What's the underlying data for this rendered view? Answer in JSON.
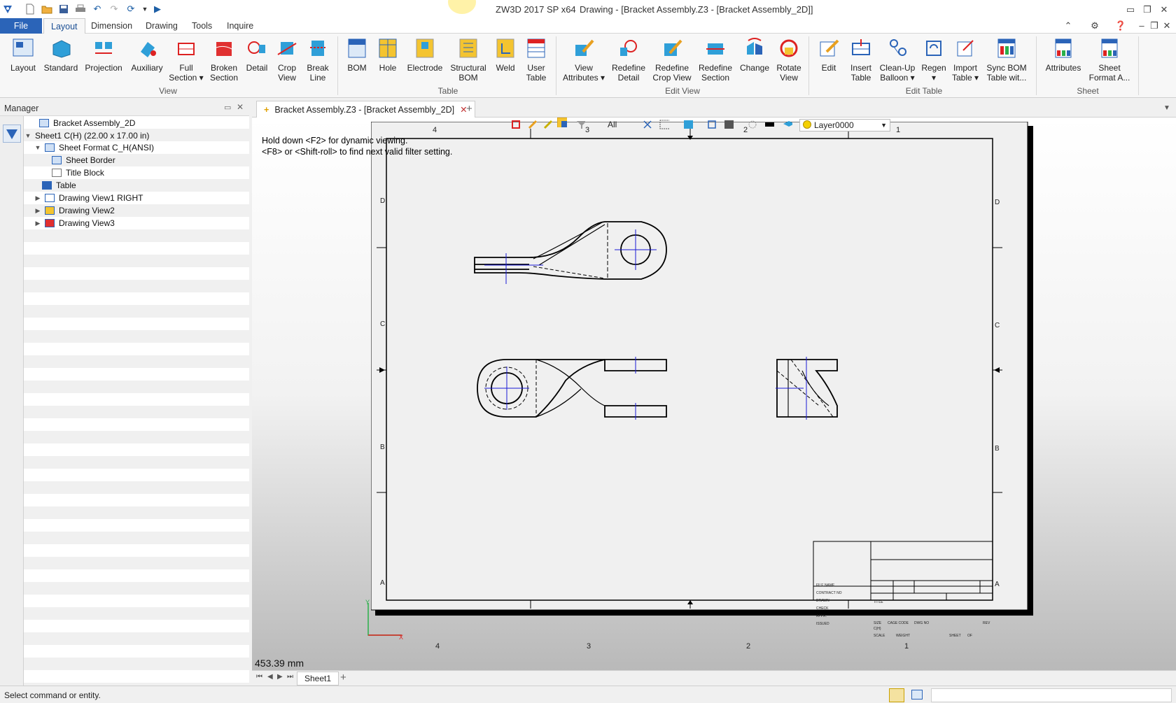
{
  "window": {
    "app_title": "ZW3D 2017 SP x64",
    "doc_title": "Drawing - [Bracket Assembly.Z3 - [Bracket Assembly_2D]]"
  },
  "menu": {
    "file": "File",
    "tabs": [
      "Layout",
      "Dimension",
      "Drawing",
      "Tools",
      "Inquire"
    ]
  },
  "ribbon": {
    "buttons": [
      {
        "l1": "Layout",
        "l2": ""
      },
      {
        "l1": "Standard",
        "l2": ""
      },
      {
        "l1": "Projection",
        "l2": ""
      },
      {
        "l1": "Auxiliary",
        "l2": ""
      },
      {
        "l1": "Full",
        "l2": "Section ▾"
      },
      {
        "l1": "Broken",
        "l2": "Section"
      },
      {
        "l1": "Detail",
        "l2": ""
      },
      {
        "l1": "Crop",
        "l2": "View"
      },
      {
        "l1": "Break",
        "l2": "Line"
      },
      {
        "l1": "BOM",
        "l2": ""
      },
      {
        "l1": "Hole",
        "l2": ""
      },
      {
        "l1": "Electrode",
        "l2": ""
      },
      {
        "l1": "Structural",
        "l2": "BOM"
      },
      {
        "l1": "Weld",
        "l2": ""
      },
      {
        "l1": "User",
        "l2": "Table"
      },
      {
        "l1": "View",
        "l2": "Attributes ▾"
      },
      {
        "l1": "Redefine",
        "l2": "Detail"
      },
      {
        "l1": "Redefine",
        "l2": "Crop View"
      },
      {
        "l1": "Redefine",
        "l2": "Section"
      },
      {
        "l1": "Change",
        "l2": ""
      },
      {
        "l1": "Rotate",
        "l2": "View"
      },
      {
        "l1": "Edit",
        "l2": ""
      },
      {
        "l1": "Insert",
        "l2": "Table"
      },
      {
        "l1": "Clean-Up",
        "l2": "Balloon ▾"
      },
      {
        "l1": "Regen",
        "l2": "▾"
      },
      {
        "l1": "Import",
        "l2": "Table ▾"
      },
      {
        "l1": "Sync BOM",
        "l2": "Table wit..."
      },
      {
        "l1": "Attributes",
        "l2": ""
      },
      {
        "l1": "Sheet",
        "l2": "Format A..."
      }
    ],
    "groups": [
      "View",
      "Table",
      "Edit View",
      "Edit Table",
      "Sheet"
    ]
  },
  "manager": {
    "title": "Manager",
    "tree": [
      {
        "label": "Bracket Assembly_2D",
        "expander": ""
      },
      {
        "label": "Sheet1 C(H) (22.00 x 17.00 in)",
        "expander": "▼"
      },
      {
        "label": "Sheet Format C_H(ANSI)",
        "expander": "▼"
      },
      {
        "label": "Sheet Border",
        "expander": ""
      },
      {
        "label": "Title Block",
        "expander": ""
      },
      {
        "label": "Table",
        "expander": ""
      },
      {
        "label": "Drawing View1 RIGHT",
        "expander": "▶"
      },
      {
        "label": "Drawing View2",
        "expander": "▶"
      },
      {
        "label": "Drawing View3",
        "expander": "▶"
      }
    ]
  },
  "doc_tab": {
    "label": "Bracket Assembly.Z3 - [Bracket Assembly_2D]",
    "close": "✕",
    "add": "+"
  },
  "canvas": {
    "hint1": "Hold down <F2> for dynamic viewing.",
    "hint2": "<F8> or <Shift-roll> to find next valid filter setting.",
    "filter": "All",
    "layer": "Layer0000",
    "measurement": "453.39 mm",
    "zone_cols": [
      "4",
      "3",
      "2",
      "1"
    ],
    "zone_rows": [
      "D",
      "C",
      "B",
      "A"
    ],
    "title_block": {
      "file_name": "FILE NAME",
      "contract_no": "CONTRACT NO",
      "drawn": "DRAWN",
      "check": "CHECK",
      "appr": "APPR.",
      "issued": "ISSUED",
      "title": "TITLE",
      "size": "SIZE",
      "size_val": "C(H)",
      "cage_code": "CAGE CODE",
      "dwg_no": "DWG NO",
      "rev": "REV",
      "scale": "SCALE",
      "weight": "WEIGHT",
      "sheet": "SHEET",
      "of": "OF"
    }
  },
  "sheet_tabs": {
    "sheet": "Sheet1",
    "add": "+"
  },
  "status": {
    "text": "Select command or entity."
  },
  "colors": {
    "accent": "#2b64b8",
    "drawing_line": "#000000",
    "centerline": "#1a1ad6"
  }
}
